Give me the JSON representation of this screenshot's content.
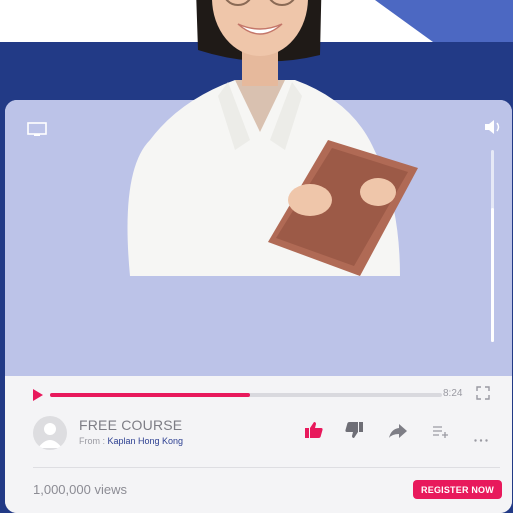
{
  "player": {
    "time": "8:24",
    "progress_percent": 51,
    "volume_percent": 70
  },
  "video": {
    "cast_icon": "cast-icon",
    "volume_icon": "volume-icon"
  },
  "course": {
    "title": "FREE COURSE",
    "from_label": "From : ",
    "provider": "Kaplan Hong Kong"
  },
  "actions": [
    "thumbs-up-icon",
    "thumbs-down-icon",
    "share-icon",
    "add-to-playlist-icon",
    "more-icon"
  ],
  "stats": {
    "views": "1,000,000 views"
  },
  "cta": {
    "register_label": "REGISTER NOW"
  },
  "colors": {
    "accent": "#e8195c",
    "navy": "#223a86",
    "tab_blue": "#4c68c2",
    "video_bg": "#bcc3e8"
  }
}
